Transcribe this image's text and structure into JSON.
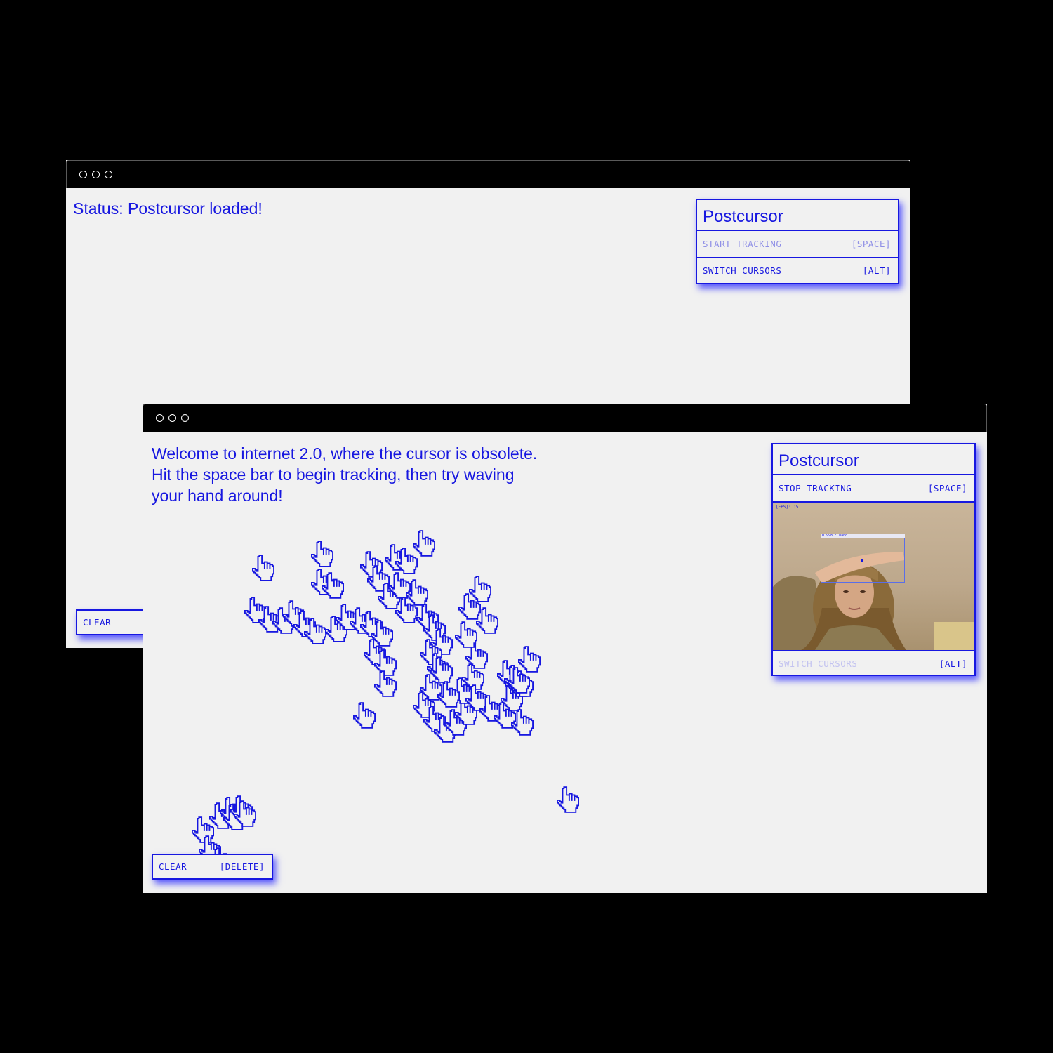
{
  "back_window": {
    "status_text": "Status: Postcursor loaded!",
    "panel": {
      "title": "Postcursor",
      "rows": [
        {
          "label": "START TRACKING",
          "key": "[SPACE]"
        },
        {
          "label": "SWITCH CURSORS",
          "key": "[ALT]"
        }
      ]
    },
    "clear_label": "CLEAR"
  },
  "front_window": {
    "welcome_lines": [
      "Welcome to internet 2.0, where the cursor is obsolete.",
      "Hit the space bar to begin tracking, then try waving",
      "your hand around!"
    ],
    "panel": {
      "title": "Postcursor",
      "stop_label": "STOP TRACKING",
      "stop_key": "[SPACE]",
      "fps_text": "[FPS]: 15",
      "detection_label": "0.998 : hand",
      "switch_label": "SWITCH CURSORS",
      "switch_key": "[ALT]"
    },
    "clear_label": "CLEAR",
    "clear_key": "[DELETE]"
  },
  "colors": {
    "accent": "#1717e0",
    "background": "#f1f1f1",
    "frame": "#000000"
  },
  "icons": {
    "cursor": "pointing-hand-cursor-icon",
    "window_controls": "window-control-dot-icon"
  }
}
